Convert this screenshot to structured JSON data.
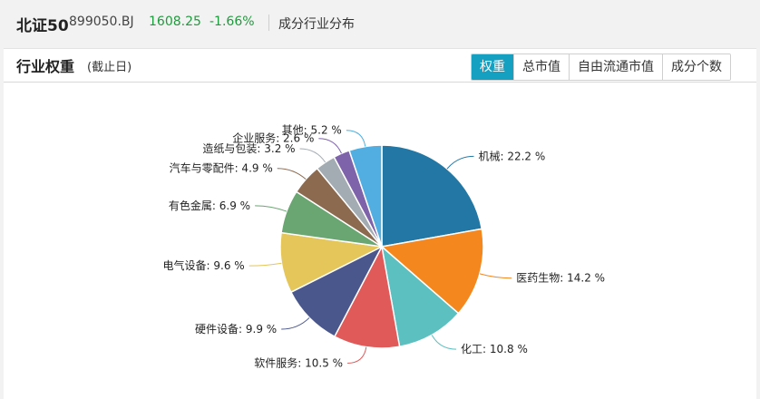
{
  "header": {
    "index_name": "北证50",
    "index_code": "899050.BJ",
    "price": "1608.25",
    "change": "-1.66%",
    "subtitle": "成分行业分布",
    "change_color": "#1e9b3c"
  },
  "panel": {
    "title": "行业权重",
    "note": "(截止日)",
    "tabs": [
      {
        "label": "权重",
        "active": true
      },
      {
        "label": "总市值",
        "active": false
      },
      {
        "label": "自由流通市值",
        "active": false
      },
      {
        "label": "成分个数",
        "active": false
      }
    ],
    "accent_color": "#15a0c2"
  },
  "chart_data": {
    "type": "pie",
    "unit": "%",
    "slices": [
      {
        "name": "机械",
        "value": 22.2,
        "label": "机械: 22.2 %",
        "color": "#2277a5"
      },
      {
        "name": "医药生物",
        "value": 14.2,
        "label": "医药生物: 14.2 %",
        "color": "#f5871f"
      },
      {
        "name": "化工",
        "value": 10.8,
        "label": "化工: 10.8 %",
        "color": "#5cbfc0"
      },
      {
        "name": "软件服务",
        "value": 10.5,
        "label": "软件服务: 10.5 %",
        "color": "#e05a5a"
      },
      {
        "name": "硬件设备",
        "value": 9.9,
        "label": "硬件设备: 9.9 %",
        "color": "#4a578c"
      },
      {
        "name": "电气设备",
        "value": 9.6,
        "label": "电气设备: 9.6 %",
        "color": "#e4c65b"
      },
      {
        "name": "有色金属",
        "value": 6.9,
        "label": "有色金属: 6.9 %",
        "color": "#6aa672"
      },
      {
        "name": "汽车与零配件",
        "value": 4.9,
        "label": "汽车与零配件: 4.9 %",
        "color": "#8c6a50"
      },
      {
        "name": "造纸与包装",
        "value": 3.2,
        "label": "造纸与包装: 3.2 %",
        "color": "#a4acb3"
      },
      {
        "name": "企业服务",
        "value": 2.6,
        "label": "企业服务: 2.6 %",
        "color": "#7e63ab"
      },
      {
        "name": "其他",
        "value": 5.2,
        "label": "其他: 5.2 %",
        "color": "#52aee0"
      }
    ]
  }
}
